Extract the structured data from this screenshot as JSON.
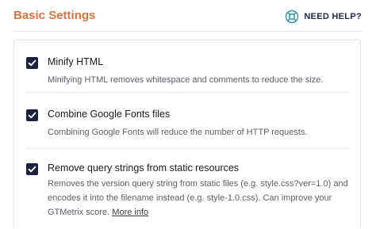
{
  "header": {
    "title": "Basic Settings",
    "help_label": "NEED HELP?",
    "help_icon": "lifebuoy-icon"
  },
  "colors": {
    "title": "#d9743f",
    "help_icon": "#2e9aa6",
    "checkbox": "#1c2140"
  },
  "options": [
    {
      "label": "Minify HTML",
      "checked": true,
      "description": "Minifying HTML removes whitespace and comments to reduce the size."
    },
    {
      "label": "Combine Google Fonts files",
      "checked": true,
      "description": "Combining Google Fonts will reduce the number of HTTP requests."
    },
    {
      "label": "Remove query strings from static resources",
      "checked": true,
      "description": "Removes the version query string from static files (e.g. style.css?ver=1.0) and encodes it into the filename instead (e.g. style-1.0.css). Can improve your GTMetrix score.",
      "link_label": "More info"
    }
  ]
}
